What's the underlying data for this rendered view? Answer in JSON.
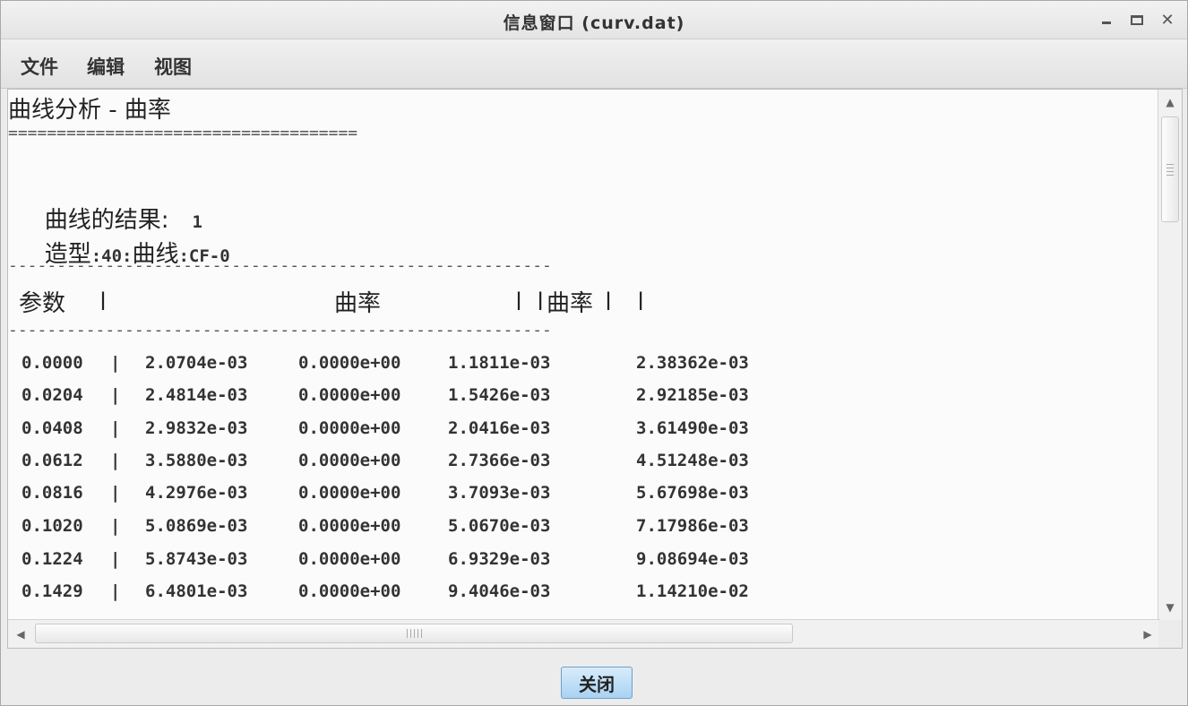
{
  "window": {
    "title": "信息窗口 (curv.dat)"
  },
  "menu": {
    "file": "文件",
    "edit": "编辑",
    "view": "视图"
  },
  "report": {
    "heading": "曲线分析 - 曲率",
    "double_rule": "====================================",
    "result_label": "曲线的结果:",
    "result_value": "1",
    "feature_prefix": "造型",
    "feature_code1": ":40:",
    "feature_name": "曲线",
    "feature_code2": ":CF-0",
    "rule": "--------------------------------------------------------",
    "header": {
      "param": "参数",
      "bar1": "|",
      "curvature": "曲率",
      "bar2": "| |",
      "abs_curvature": "曲率",
      "bar3": "|  |"
    },
    "rows": [
      [
        "0.0000",
        "|",
        "2.0704e-03",
        "0.0000e+00",
        "1.1811e-03",
        "2.38362e-03"
      ],
      [
        "0.0204",
        "|",
        "2.4814e-03",
        "0.0000e+00",
        "1.5426e-03",
        "2.92185e-03"
      ],
      [
        "0.0408",
        "|",
        "2.9832e-03",
        "0.0000e+00",
        "2.0416e-03",
        "3.61490e-03"
      ],
      [
        "0.0612",
        "|",
        "3.5880e-03",
        "0.0000e+00",
        "2.7366e-03",
        "4.51248e-03"
      ],
      [
        "0.0816",
        "|",
        "4.2976e-03",
        "0.0000e+00",
        "3.7093e-03",
        "5.67698e-03"
      ],
      [
        "0.1020",
        "|",
        "5.0869e-03",
        "0.0000e+00",
        "5.0670e-03",
        "7.17986e-03"
      ],
      [
        "0.1224",
        "|",
        "5.8743e-03",
        "0.0000e+00",
        "6.9329e-03",
        "9.08694e-03"
      ],
      [
        "0.1429",
        "|",
        "6.4801e-03",
        "0.0000e+00",
        "9.4046e-03",
        "1.14210e-02"
      ]
    ]
  },
  "buttons": {
    "close": "关闭"
  }
}
